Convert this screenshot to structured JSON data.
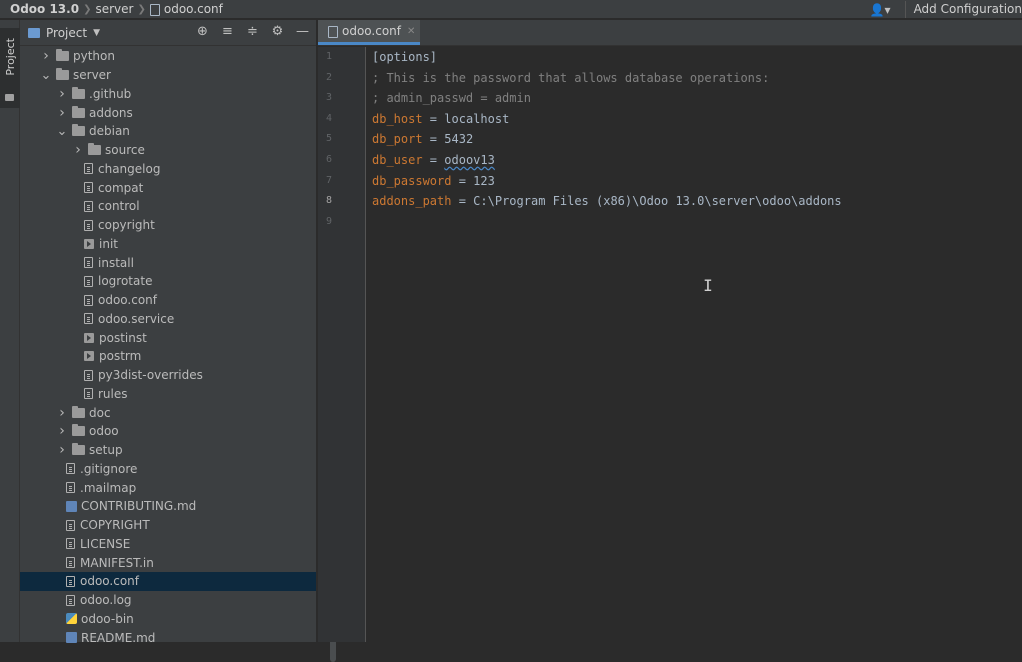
{
  "breadcrumb": {
    "project": "Odoo 13.0",
    "folder": "server",
    "file": "odoo.conf"
  },
  "toolbar": {
    "add_configuration": "Add Configuration"
  },
  "left_strip": {
    "project_tab": "Project"
  },
  "project_panel": {
    "title": "Project",
    "tree": [
      {
        "name": "python",
        "type": "folder",
        "expanded": false
      },
      {
        "name": "server",
        "type": "folder",
        "expanded": true
      },
      {
        "name": ".github",
        "type": "folder",
        "expanded": false
      },
      {
        "name": "addons",
        "type": "folder",
        "expanded": false
      },
      {
        "name": "debian",
        "type": "folder",
        "expanded": true
      },
      {
        "name": "source",
        "type": "folder",
        "expanded": false
      },
      {
        "name": "changelog",
        "type": "file"
      },
      {
        "name": "compat",
        "type": "file"
      },
      {
        "name": "control",
        "type": "file"
      },
      {
        "name": "copyright",
        "type": "file"
      },
      {
        "name": "init",
        "type": "exec"
      },
      {
        "name": "install",
        "type": "file"
      },
      {
        "name": "logrotate",
        "type": "file"
      },
      {
        "name": "odoo.conf",
        "type": "file"
      },
      {
        "name": "odoo.service",
        "type": "file"
      },
      {
        "name": "postinst",
        "type": "exec"
      },
      {
        "name": "postrm",
        "type": "exec"
      },
      {
        "name": "py3dist-overrides",
        "type": "file"
      },
      {
        "name": "rules",
        "type": "file"
      },
      {
        "name": "doc",
        "type": "folder",
        "expanded": false
      },
      {
        "name": "odoo",
        "type": "folder",
        "expanded": false
      },
      {
        "name": "setup",
        "type": "folder",
        "expanded": false
      },
      {
        "name": ".gitignore",
        "type": "file"
      },
      {
        "name": ".mailmap",
        "type": "file"
      },
      {
        "name": "CONTRIBUTING.md",
        "type": "markdown"
      },
      {
        "name": "COPYRIGHT",
        "type": "file"
      },
      {
        "name": "LICENSE",
        "type": "file"
      },
      {
        "name": "MANIFEST.in",
        "type": "file"
      },
      {
        "name": "odoo.conf",
        "type": "file",
        "selected": true
      },
      {
        "name": "odoo.log",
        "type": "file"
      },
      {
        "name": "odoo-bin",
        "type": "python"
      },
      {
        "name": "README.md",
        "type": "markdown"
      }
    ]
  },
  "editor": {
    "tab_label": "odoo.conf",
    "line_numbers": [
      "1",
      "2",
      "3",
      "4",
      "5",
      "6",
      "7",
      "8",
      "9"
    ],
    "lines": {
      "section": "[options]",
      "comment1": "; This is the password that allows database operations:",
      "comment2": "; admin_passwd = admin",
      "db_host_key": "db_host",
      "db_host_val": "localhost",
      "db_port_key": "db_port",
      "db_port_val": "5432",
      "db_user_key": "db_user",
      "db_user_val": "odoov13",
      "db_password_key": "db_password",
      "db_password_val": "123",
      "addons_path_key": "addons_path",
      "addons_path_val": "C:\\Program Files (x86)\\Odoo 13.0\\server\\odoo\\addons",
      "equals": " = "
    }
  },
  "colors": {
    "accent": "#4a88c7",
    "keyword": "#cc7832",
    "comment": "#808080",
    "selection": "#0d293e"
  }
}
